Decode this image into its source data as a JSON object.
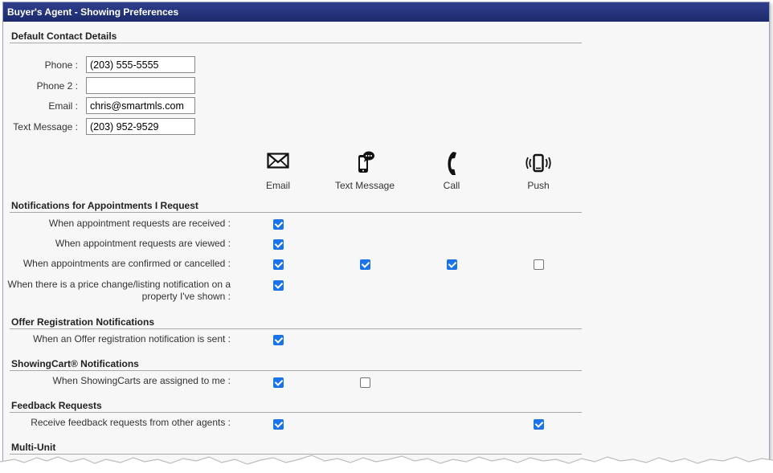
{
  "title": "Buyer's Agent - Showing Preferences",
  "contact": {
    "heading": "Default Contact Details",
    "phone_label": "Phone :",
    "phone_value": "(203) 555-5555",
    "phone2_label": "Phone 2 :",
    "phone2_value": "",
    "email_label": "Email :",
    "email_value": "chris@smartmls.com",
    "text_label": "Text Message :",
    "text_value": "(203) 952-9529"
  },
  "columns": {
    "email": {
      "label": "Email",
      "icon": "envelope-icon"
    },
    "text": {
      "label": "Text Message",
      "icon": "phone-message-icon"
    },
    "call": {
      "label": "Call",
      "icon": "handset-icon"
    },
    "push": {
      "label": "Push",
      "icon": "vibrating-phone-icon"
    }
  },
  "sections": {
    "appointments": {
      "heading": "Notifications for Appointments I Request",
      "rows": [
        {
          "label": "When appointment requests are received :",
          "email": true
        },
        {
          "label": "When appointment requests are viewed :",
          "email": true
        },
        {
          "label": "When appointments are confirmed or cancelled :",
          "email": true,
          "text": true,
          "call": true,
          "push": false
        },
        {
          "label": "When there is a price change/listing notification on a property I've shown :",
          "email": true
        }
      ]
    },
    "offer": {
      "heading": "Offer Registration Notifications",
      "rows": [
        {
          "label": "When an Offer registration notification is sent :",
          "email": true
        }
      ]
    },
    "showingcart": {
      "heading": "ShowingCart® Notifications",
      "rows": [
        {
          "label": "When ShowingCarts are assigned to me :",
          "email": true,
          "text": false
        }
      ]
    },
    "feedback": {
      "heading": "Feedback Requests",
      "rows": [
        {
          "label": "Receive feedback requests from other agents :",
          "email": true,
          "push": true
        }
      ]
    },
    "multiunit": {
      "heading": "Multi-Unit"
    }
  },
  "colors": {
    "titlebar": "#1c2a6b",
    "checkbox_checked": "#1a73e8",
    "background": "#f7f7f7"
  }
}
